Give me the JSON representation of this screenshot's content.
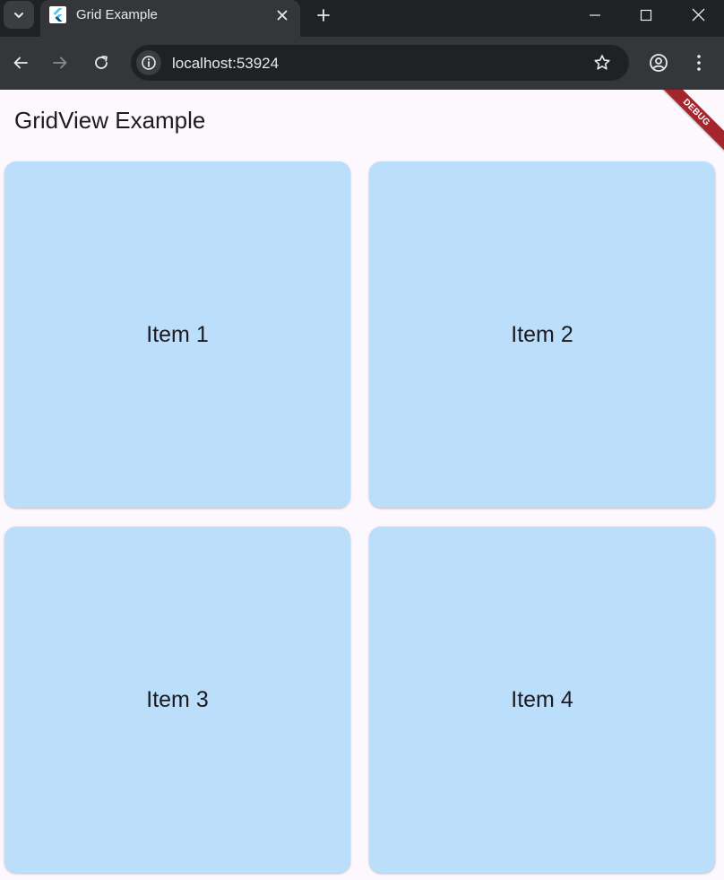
{
  "browser": {
    "tab_title": "Grid Example",
    "url": "localhost:53924",
    "icons": {
      "tab_list": "chevron-down-icon",
      "favicon": "flutter-logo-icon",
      "tab_close": "close-icon",
      "new_tab": "plus-icon",
      "minimize": "minimize-icon",
      "maximize": "maximize-icon",
      "close_window": "close-icon",
      "back": "arrow-left-icon",
      "forward": "arrow-right-icon",
      "reload": "reload-icon",
      "site_info": "info-icon",
      "bookmark": "star-icon",
      "profile": "profile-icon",
      "menu": "more-vertical-icon"
    }
  },
  "app": {
    "title": "GridView Example",
    "debug_banner": "DEBUG",
    "items": [
      {
        "label": "Item 1"
      },
      {
        "label": "Item 2"
      },
      {
        "label": "Item 3"
      },
      {
        "label": "Item 4"
      }
    ],
    "colors": {
      "background": "#fdf7fe",
      "item_background": "#bbdefb",
      "text": "#1d1b20",
      "debug_banner": "#a4262c"
    }
  }
}
